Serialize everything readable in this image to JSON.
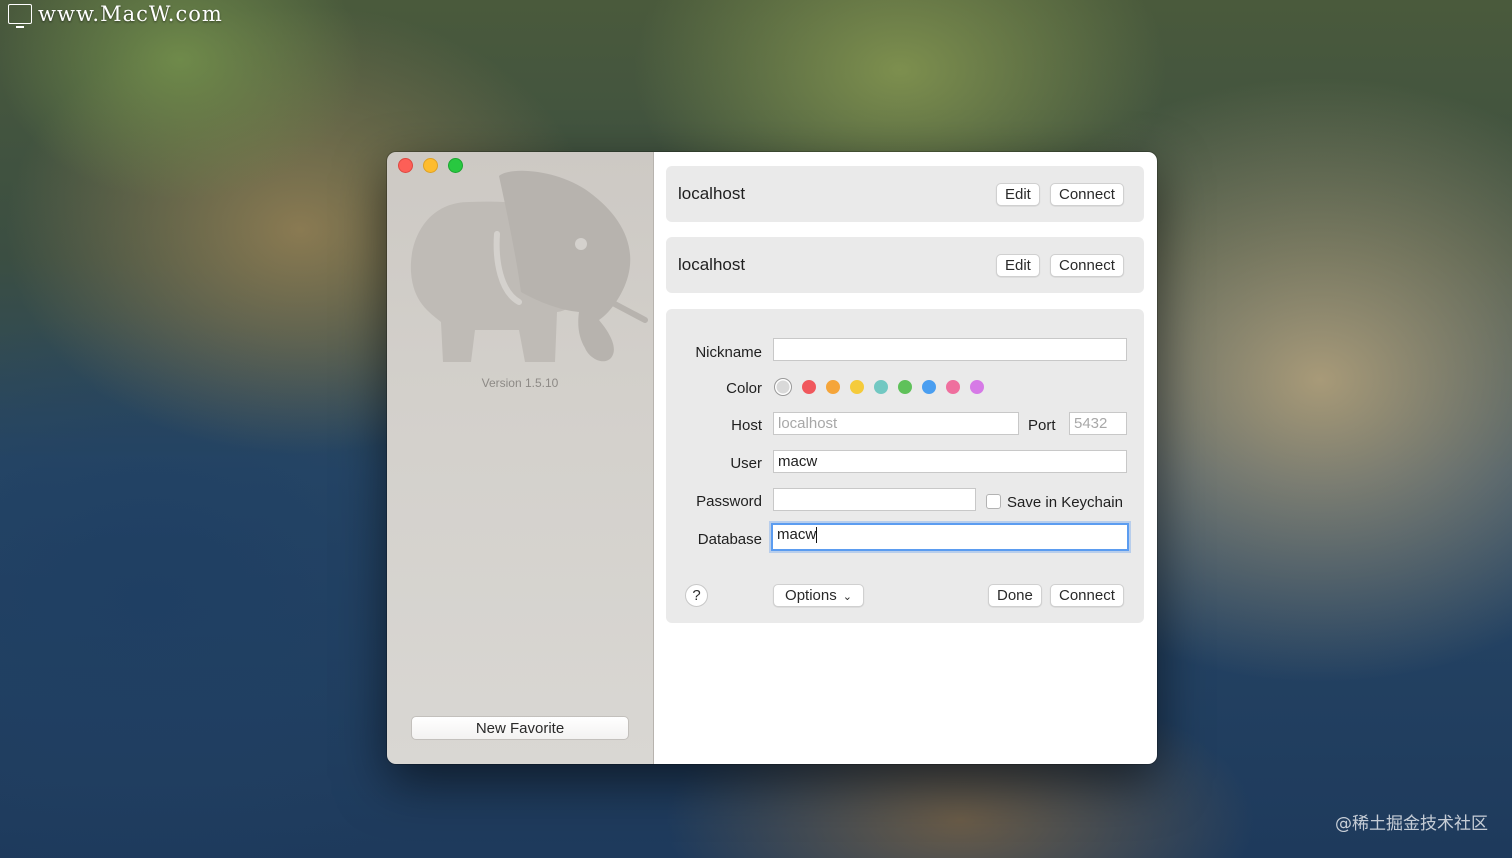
{
  "watermark": {
    "site": "www.MacW.com",
    "corner": "@稀土掘金技术社区"
  },
  "app": {
    "version": "Version 1.5.10",
    "new_favorite_label": "New Favorite"
  },
  "favorites": [
    {
      "name": "localhost",
      "edit_label": "Edit",
      "connect_label": "Connect"
    },
    {
      "name": "localhost",
      "edit_label": "Edit",
      "connect_label": "Connect"
    }
  ],
  "form": {
    "nickname_label": "Nickname",
    "nickname_value": "",
    "color_label": "Color",
    "colors": [
      "none",
      "#f0585d",
      "#f5a53a",
      "#f5cb3b",
      "#72c8c2",
      "#5fc15a",
      "#4a9ef0",
      "#ef6f9e",
      "#d67ae6"
    ],
    "host_label": "Host",
    "host_placeholder": "localhost",
    "port_label": "Port",
    "port_placeholder": "5432",
    "user_label": "User",
    "user_value": "macw",
    "password_label": "Password",
    "password_value": "",
    "save_keychain_label": "Save in Keychain",
    "save_keychain_checked": false,
    "database_label": "Database",
    "database_value": "macw",
    "help_label": "?",
    "options_label": "Options",
    "done_label": "Done",
    "connect_label": "Connect"
  }
}
